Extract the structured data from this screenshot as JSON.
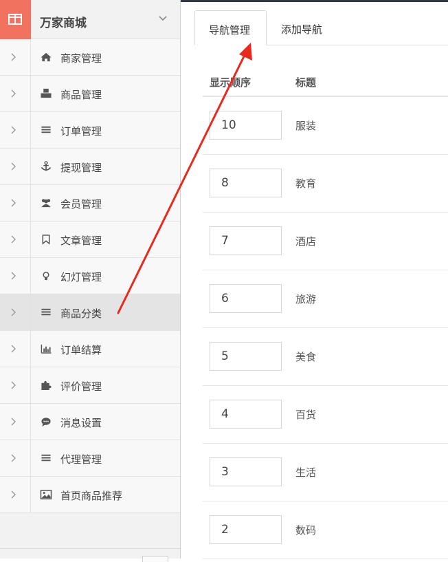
{
  "brand": {
    "title": "万家商城"
  },
  "sidebar": {
    "items": [
      {
        "label": "商家管理",
        "icon": "home-icon",
        "active": false
      },
      {
        "label": "商品管理",
        "icon": "cubes-icon",
        "active": false
      },
      {
        "label": "订单管理",
        "icon": "list-icon",
        "active": false
      },
      {
        "label": "提现管理",
        "icon": "anchor-icon",
        "active": false
      },
      {
        "label": "会员管理",
        "icon": "users-icon",
        "active": false
      },
      {
        "label": "文章管理",
        "icon": "bookmark-icon",
        "active": false
      },
      {
        "label": "幻灯管理",
        "icon": "lightbulb-icon",
        "active": false
      },
      {
        "label": "商品分类",
        "icon": "list-icon",
        "active": true
      },
      {
        "label": "订单结算",
        "icon": "bar-chart-icon",
        "active": false
      },
      {
        "label": "评价管理",
        "icon": "puzzle-icon",
        "active": false
      },
      {
        "label": "消息设置",
        "icon": "comment-icon",
        "active": false
      },
      {
        "label": "代理管理",
        "icon": "list-icon",
        "active": false
      },
      {
        "label": "首页商品推荐",
        "icon": "image-icon",
        "active": false
      }
    ]
  },
  "tabs": [
    {
      "label": "导航管理",
      "active": true
    },
    {
      "label": "添加导航",
      "active": false
    }
  ],
  "table": {
    "headers": {
      "order": "显示顺序",
      "title": "标题"
    },
    "rows": [
      {
        "order": "10",
        "title": "服装"
      },
      {
        "order": "8",
        "title": "教育"
      },
      {
        "order": "7",
        "title": "酒店"
      },
      {
        "order": "6",
        "title": "旅游"
      },
      {
        "order": "5",
        "title": "美食"
      },
      {
        "order": "4",
        "title": "百货"
      },
      {
        "order": "3",
        "title": "生活"
      },
      {
        "order": "2",
        "title": "数码"
      }
    ]
  },
  "colors": {
    "brand_accent": "#f1735f",
    "annotation_arrow": "#e8291c",
    "top_bar": "#2f3a45"
  }
}
